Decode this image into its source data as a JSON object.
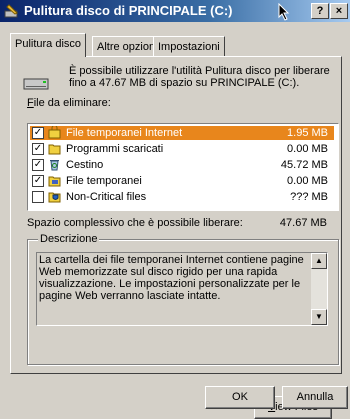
{
  "titlebar": {
    "title": "Pulitura disco di PRINCIPALE (C:)",
    "help_label": "?",
    "close_label": "×"
  },
  "tabs": [
    {
      "label": "Pulitura disco",
      "active": true
    },
    {
      "label": "Altre opzioni",
      "active": false
    },
    {
      "label": "Impostazioni",
      "active": false
    }
  ],
  "intro": "È possibile utilizzare l'utilità Pulitura disco per liberare fino a 47.67 MB di spazio su PRINCIPALE (C:).",
  "files_label_first": "F",
  "files_label_rest": "ile da eliminare:",
  "files": [
    {
      "name": "File temporanei Internet",
      "size": "1.95 MB",
      "checked": true,
      "selected": true,
      "icon": "lock-folder-icon"
    },
    {
      "name": "Programmi scaricati",
      "size": "0.00 MB",
      "checked": true,
      "selected": false,
      "icon": "folder-icon"
    },
    {
      "name": "Cestino",
      "size": "45.72 MB",
      "checked": true,
      "selected": false,
      "icon": "recycle-bin-icon"
    },
    {
      "name": "File temporanei",
      "size": "0.00 MB",
      "checked": true,
      "selected": false,
      "icon": "temp-files-icon"
    },
    {
      "name": "Non-Critical files",
      "size": "??? MB",
      "checked": false,
      "selected": false,
      "icon": "shield-files-icon"
    }
  ],
  "total_label": "Spazio complessivo che è possibile liberare:",
  "total_value": "47.67 MB",
  "description": {
    "title": "Descrizione",
    "text": "La cartella dei file temporanei Internet contiene pagine Web memorizzate sul disco rigido per una rapida visualizzazione. Le impostazioni personalizzate per le pagine Web verranno lasciate intatte."
  },
  "view_files_first": "V",
  "view_files_rest": "iew Files",
  "ok_label": "OK",
  "cancel_label": "Annulla",
  "colors": {
    "selection": "#e8861c",
    "title_start": "#0a246a",
    "title_end": "#a6caf0",
    "face": "#d4d0c8"
  }
}
